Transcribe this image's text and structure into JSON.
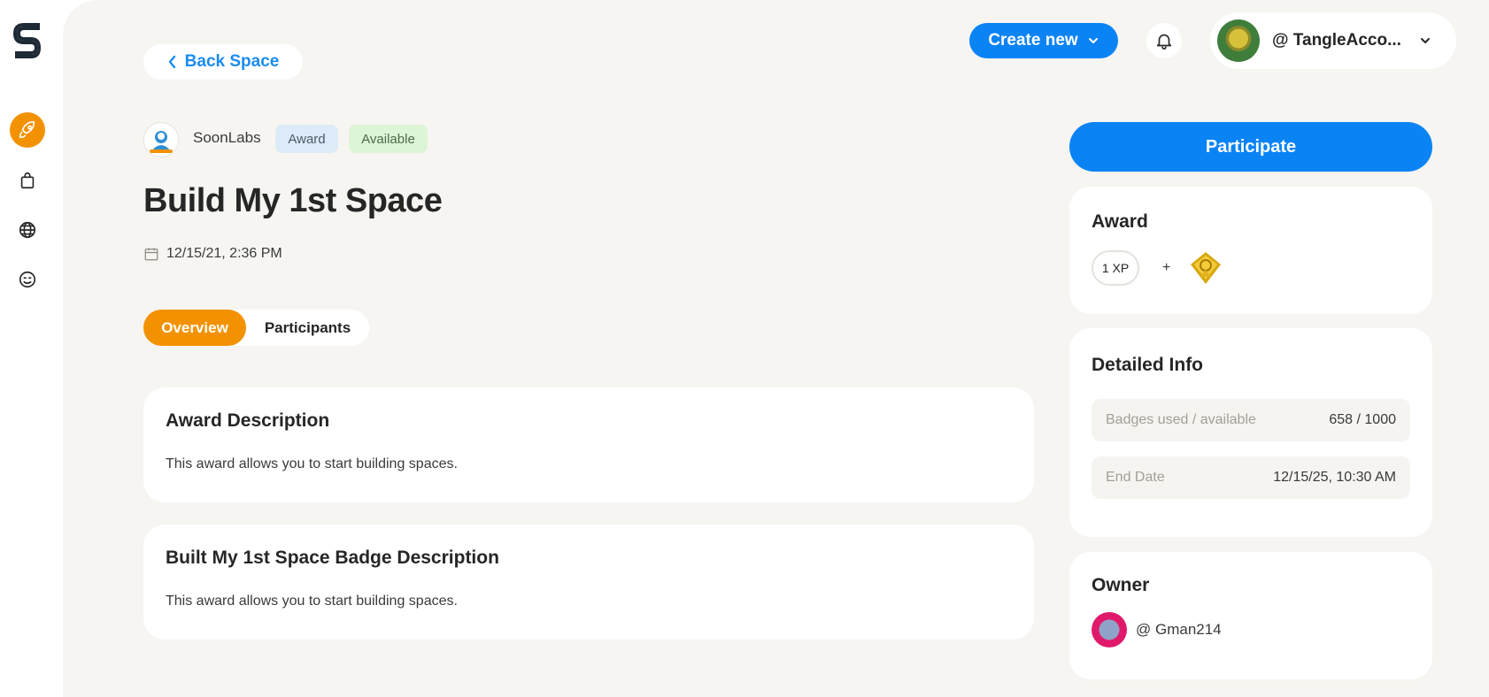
{
  "header": {
    "back_label": "Back Space",
    "create_label": "Create new",
    "account_name": "@ TangleAcco..."
  },
  "space": {
    "name": "SoonLabs",
    "badges": [
      "Award",
      "Available"
    ],
    "title": "Build My 1st Space",
    "date": "12/15/21, 2:36 PM"
  },
  "tabs": [
    "Overview",
    "Participants"
  ],
  "sections": [
    {
      "title": "Award Description",
      "body": "This award allows you to start building spaces."
    },
    {
      "title": "Built My 1st Space Badge Description",
      "body": "This award allows you to start building spaces."
    }
  ],
  "sidebar_right": {
    "participate_label": "Participate",
    "award": {
      "title": "Award",
      "xp": "1 XP",
      "plus": "+"
    },
    "detailed_info": {
      "title": "Detailed Info",
      "rows": [
        {
          "label": "Badges used / available",
          "value": "658 / 1000"
        },
        {
          "label": "End Date",
          "value": "12/15/25, 10:30 AM"
        }
      ]
    },
    "owner": {
      "title": "Owner",
      "name": "@ Gman214"
    }
  },
  "colors": {
    "accent_orange": "#f39200",
    "primary_blue": "#0a83f5",
    "canvas_bg": "#f6f5f1"
  },
  "icons": {
    "sidebar": [
      "rocket-icon",
      "shopping-bag-icon",
      "globe-icon",
      "smiley-icon"
    ],
    "header": [
      "chevron-left-icon",
      "chevron-down-icon",
      "bell-icon"
    ]
  }
}
